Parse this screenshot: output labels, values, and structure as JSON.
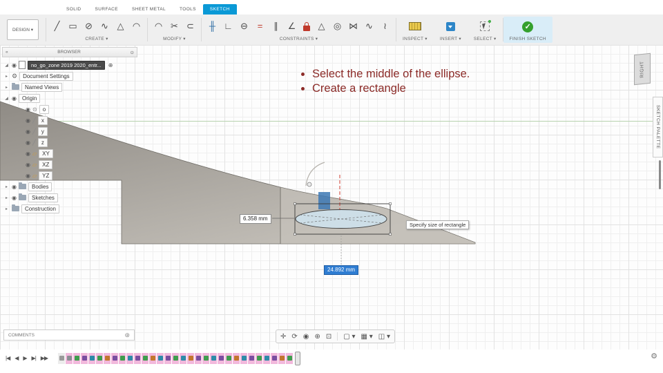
{
  "tabs": [
    {
      "label": "SOLID"
    },
    {
      "label": "SURFACE"
    },
    {
      "label": "SHEET METAL"
    },
    {
      "label": "TOOLS"
    },
    {
      "label": "SKETCH"
    }
  ],
  "toolbar": {
    "design_label": "DESIGN ▾",
    "groups": {
      "create": {
        "label": "CREATE ▾",
        "icons": [
          {
            "name": "line",
            "glyph": "╱"
          },
          {
            "name": "rectangle",
            "glyph": "▭"
          },
          {
            "name": "circle",
            "glyph": "⊘"
          },
          {
            "name": "spline",
            "glyph": "∿"
          },
          {
            "name": "polygon",
            "glyph": "△"
          },
          {
            "name": "arc",
            "glyph": "◠"
          }
        ]
      },
      "modify": {
        "label": "MODIFY ▾",
        "icons": [
          {
            "name": "fillet",
            "glyph": "◠"
          },
          {
            "name": "trim",
            "glyph": "✂"
          },
          {
            "name": "offset",
            "glyph": "⊂"
          }
        ]
      },
      "constraints": {
        "label": "CONSTRAINTS ▾",
        "icons": [
          {
            "name": "horizontal-vertical",
            "glyph": "╫",
            "color": "#2e6da4"
          },
          {
            "name": "perpendicular",
            "glyph": "∟"
          },
          {
            "name": "tangent",
            "glyph": "⊖"
          },
          {
            "name": "equal",
            "glyph": "=",
            "color": "#c0392b"
          },
          {
            "name": "parallel",
            "glyph": "∥"
          },
          {
            "name": "collinear",
            "glyph": "∠"
          },
          {
            "name": "fix",
            "type": "lock"
          },
          {
            "name": "midpoint",
            "glyph": "△"
          },
          {
            "name": "concentric",
            "glyph": "◎"
          },
          {
            "name": "symmetry",
            "glyph": "⋈"
          },
          {
            "name": "curvature",
            "glyph": "∿"
          },
          {
            "name": "smooth",
            "glyph": "≀"
          }
        ]
      },
      "inspect": {
        "label": "INSPECT ▾"
      },
      "insert": {
        "label": "INSERT ▾"
      },
      "select": {
        "label": "SELECT ▾"
      },
      "finish": {
        "label": "FINISH SKETCH",
        "check": "✓"
      }
    }
  },
  "browser": {
    "title": "BROWSER",
    "document": "no_go_zone 2019 2020_entr...",
    "rows": [
      {
        "label": "Document Settings"
      },
      {
        "label": "Named Views"
      },
      {
        "label": "Origin"
      },
      {
        "label": "Bodies"
      },
      {
        "label": "Sketches"
      },
      {
        "label": "Construction"
      }
    ],
    "origin_children": [
      {
        "label": "o",
        "glyph": "⊙",
        "color": "#777777"
      },
      {
        "label": "x",
        "glyph": "╱",
        "color": "#888888"
      },
      {
        "label": "y",
        "glyph": "╱",
        "color": "#888888"
      },
      {
        "label": "z",
        "glyph": "╱",
        "color": "#888888"
      },
      {
        "label": "XY",
        "glyph": "▱",
        "color": "#d29a38"
      },
      {
        "label": "XZ",
        "glyph": "▱",
        "color": "#d29a38"
      },
      {
        "label": "YZ",
        "glyph": "▱",
        "color": "#d29a38"
      }
    ]
  },
  "annotation": {
    "bullets": [
      "Select the middle of the ellipse.",
      "Create a rectangle"
    ]
  },
  "canvas": {
    "dim_width": "6.358 mm",
    "dim_height": "24.892 mm",
    "tooltip": "Specify size of rectangle"
  },
  "right_panel": {
    "viewcube_face": "RIGHT",
    "palette_title": "SKETCH PALETTE"
  },
  "comments": {
    "title": "COMMENTS"
  },
  "navbar": {
    "items": [
      {
        "name": "pan",
        "glyph": "✛"
      },
      {
        "name": "orbit",
        "glyph": "⟳"
      },
      {
        "name": "look-at",
        "glyph": "◉"
      },
      {
        "name": "zoom",
        "glyph": "⊕"
      },
      {
        "name": "fit",
        "glyph": "⊡"
      },
      {
        "type": "sep"
      },
      {
        "name": "display-settings",
        "glyph": "▢ ▾"
      },
      {
        "name": "grid-settings",
        "glyph": "▦ ▾"
      },
      {
        "name": "viewports",
        "glyph": "◫ ▾"
      }
    ]
  },
  "timeline": {
    "playback": [
      {
        "name": "go-to-start",
        "glyph": "|◀"
      },
      {
        "name": "step-back",
        "glyph": "◀"
      },
      {
        "name": "play",
        "glyph": "▶"
      },
      {
        "name": "step-forward",
        "glyph": "▶|"
      },
      {
        "name": "go-to-end",
        "glyph": "▶▶"
      }
    ],
    "highlight": "#f2b8dc",
    "features": [
      "#8a8f94",
      "#3f9d4e",
      "#7a4ea0",
      "#2e8ba8",
      "#3f9d4e",
      "#c2772e",
      "#7a4ea0",
      "#3f9d4e",
      "#2e8ba8",
      "#7a4ea0",
      "#3f9d4e",
      "#c2772e",
      "#2e8ba8",
      "#7a4ea0",
      "#3f9d4e",
      "#2e8ba8",
      "#c2772e",
      "#7a4ea0",
      "#3f9d4e",
      "#2e8ba8",
      "#7a4ea0",
      "#3f9d4e",
      "#c2772e",
      "#2e8ba8",
      "#7a4ea0",
      "#3f9d4e",
      "#2e8ba8",
      "#7a4ea0",
      "#c2772e",
      "#3f9d4e"
    ]
  },
  "icons": {
    "expanded": "◢",
    "collapsed": "▸",
    "eye": "◉",
    "gear": "⚙",
    "doc_badge": "⊕",
    "browser_collapse": "«",
    "browser_options": "⊙",
    "comments_options": "⊛"
  },
  "colors": {
    "accent_blue": "#0a99d6",
    "finish_green": "#35a02e",
    "timeline_pink": "#f2b8dc",
    "annotation_red": "#8c2b28"
  }
}
